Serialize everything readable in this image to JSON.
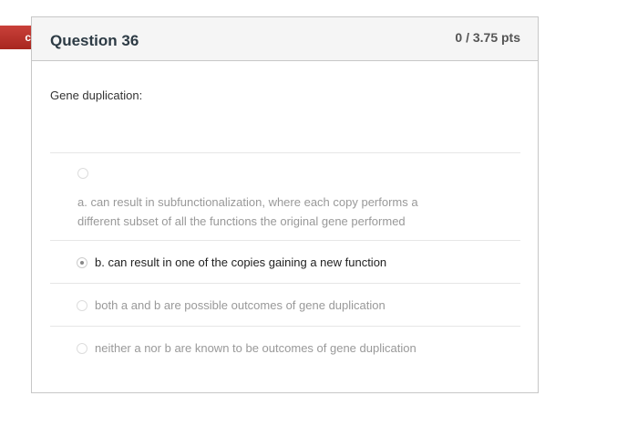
{
  "status_tag": "ct",
  "question": {
    "title": "Question 36",
    "points": "0 / 3.75 pts",
    "text": "Gene duplication:"
  },
  "answers": [
    {
      "label": "a. can result in subfunctionalization, where each copy performs a different subset of all the functions the original gene performed",
      "selected": false
    },
    {
      "label": "b. can result in one of the copies gaining a new function",
      "selected": true
    },
    {
      "label": "both a and b are possible outcomes of gene duplication",
      "selected": false
    },
    {
      "label": "neither a nor b are known to be outcomes of gene duplication",
      "selected": false
    }
  ]
}
